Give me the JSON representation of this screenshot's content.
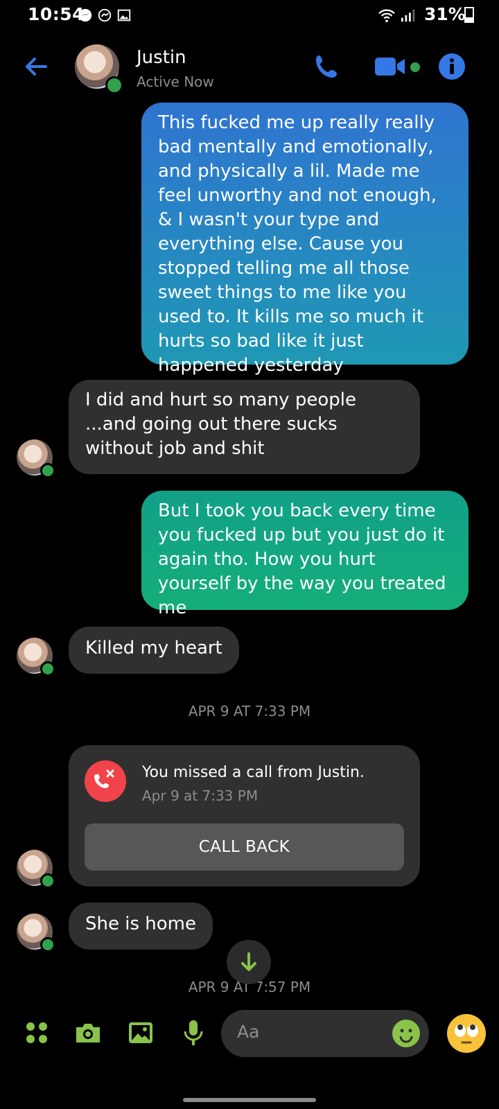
{
  "status_bar": {
    "time": "10:54",
    "battery": "31%"
  },
  "header": {
    "name": "Justin",
    "status": "Active Now"
  },
  "messages": [
    {
      "id": "m1",
      "from": "me",
      "text": "This fucked me up really really bad mentally and emotionally, and physically a lil. Made me feel unworthy and not enough, & I wasn't your type and everything else. Cause you stopped telling me all those sweet things to me like you used to. It kills me so much it hurts so bad like it just happened yesterday"
    },
    {
      "id": "m2",
      "from": "them",
      "text": "I did and hurt so many people  ...and going out there sucks without job and shit"
    },
    {
      "id": "m3",
      "from": "me",
      "text": "But I took you back every time you fucked up but you just do it again tho. How you hurt yourself by the way you treated me"
    },
    {
      "id": "m4",
      "from": "them",
      "text": "Killed my heart"
    },
    {
      "id": "m6",
      "from": "them",
      "text": "She is home"
    }
  ],
  "timestamps": [
    "APR 9 AT 7:33 PM",
    "APR 9 AT 7:57 PM"
  ],
  "missed_call": {
    "title": "You missed a call from Justin.",
    "time": "Apr 9 at 7:33 PM",
    "button": "CALL BACK"
  },
  "composer": {
    "placeholder": "Aa"
  },
  "colors": {
    "accent": "#3578e5",
    "online": "#31a24c",
    "composer_icons": "#8ac34a",
    "missed_call": "#f0444a"
  }
}
